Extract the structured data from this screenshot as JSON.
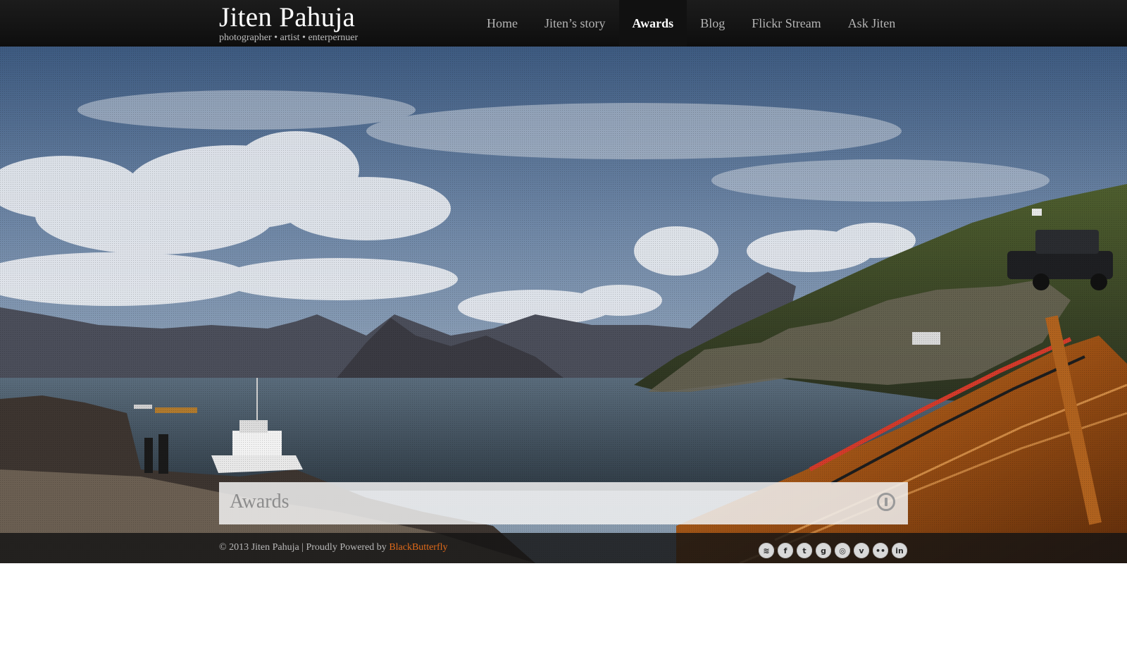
{
  "header": {
    "site_title": "Jiten Pahuja",
    "tagline": "photographer • artist • enterpernuer",
    "nav": [
      {
        "label": "Home",
        "active": false
      },
      {
        "label": "Jiten’s story",
        "active": false
      },
      {
        "label": "Awards",
        "active": true
      },
      {
        "label": "Blog",
        "active": false
      },
      {
        "label": "Flickr Stream",
        "active": false
      },
      {
        "label": "Ask Jiten",
        "active": false
      }
    ]
  },
  "hero": {
    "title": "Awards",
    "info_icon": "info-icon"
  },
  "footer": {
    "copyright_prefix": "© 2013 Jiten Pahuja | Proudly Powered by",
    "powered_link": "BlackButterfly",
    "social": [
      {
        "name": "rss-icon",
        "glyph": "≋"
      },
      {
        "name": "facebook-icon",
        "glyph": "f"
      },
      {
        "name": "twitter-icon",
        "glyph": "t"
      },
      {
        "name": "google-plus-icon",
        "glyph": "g"
      },
      {
        "name": "picasa-icon",
        "glyph": "◎"
      },
      {
        "name": "vimeo-icon",
        "glyph": "v"
      },
      {
        "name": "flickr-icon",
        "glyph": "••"
      },
      {
        "name": "linkedin-icon",
        "glyph": "in"
      }
    ]
  },
  "colors": {
    "link_accent": "#e06a1a",
    "header_bg": "#151515"
  }
}
